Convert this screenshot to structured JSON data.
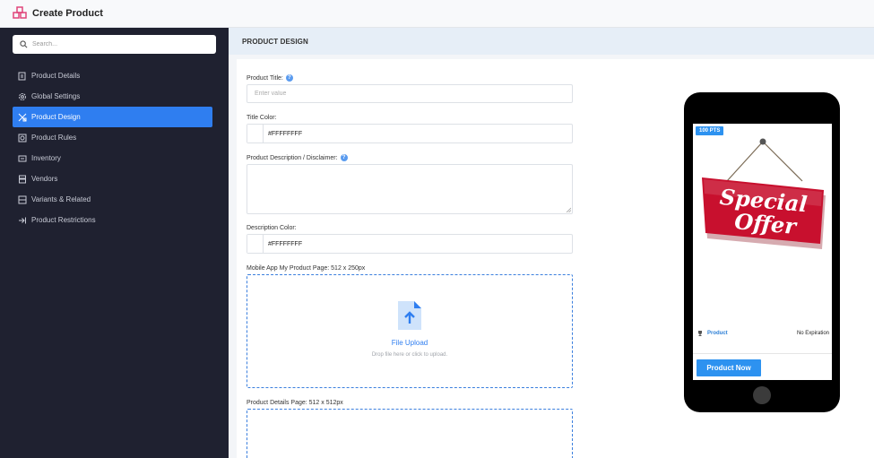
{
  "window": {
    "title": "Create Product",
    "logo_icon": "product-boxes-icon"
  },
  "sidebar": {
    "search_placeholder": "Search...",
    "items": [
      {
        "label": "Product Details",
        "icon": "product-details-icon",
        "active": false
      },
      {
        "label": "Global Settings",
        "icon": "gear-icon",
        "active": false
      },
      {
        "label": "Product Design",
        "icon": "design-tools-icon",
        "active": true
      },
      {
        "label": "Product Rules",
        "icon": "rules-icon",
        "active": false
      },
      {
        "label": "Inventory",
        "icon": "inventory-icon",
        "active": false
      },
      {
        "label": "Vendors",
        "icon": "vendors-icon",
        "active": false
      },
      {
        "label": "Variants & Related",
        "icon": "variants-icon",
        "active": false
      },
      {
        "label": "Product Restrictions",
        "icon": "restrictions-icon",
        "active": false
      }
    ]
  },
  "main": {
    "section_title": "PRODUCT DESIGN",
    "form": {
      "title_label": "Product Title:",
      "title_placeholder": "Enter value",
      "title_value": "",
      "title_color_label": "Title Color:",
      "title_color_value": "#FFFFFFFF",
      "description_label": "Product Description / Disclaimer:",
      "description_value": "",
      "description_color_label": "Description Color:",
      "description_color_value": "#FFFFFFFF",
      "mobile_upload_label": "Mobile App My Product Page: 512 x 250px",
      "upload_title": "File Upload",
      "upload_hint": "Drop file here or click to upload.",
      "details_upload_label": "Product Details Page: 512 x 512px"
    },
    "preview": {
      "points_badge": "100 PTS",
      "product_label": "Product",
      "expiration": "No Expiration",
      "cta_label": "Product Now",
      "image_text_line1": "Special",
      "image_text_line2": "Offer"
    }
  },
  "colors": {
    "accent": "#2f7ef0",
    "sidebar_bg": "#1f2130",
    "badge": "#2d92f0",
    "sign_red": "#c8102e"
  }
}
